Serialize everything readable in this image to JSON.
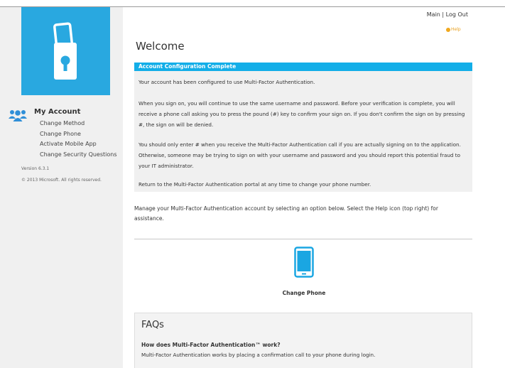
{
  "top_nav": {
    "main_label": "Main",
    "separator": " | ",
    "logout_label": "Log Out"
  },
  "help": {
    "label": "Help"
  },
  "sidebar": {
    "logo_icon": "phone-lock-icon",
    "account_icon": "users-icon",
    "account_title": "My Account",
    "links": [
      "Change Method",
      "Change Phone",
      "Activate Mobile App",
      "Change Security Questions"
    ],
    "version": "Version 6.3.1",
    "copyright": "© 2013 Microsoft. All rights reserved."
  },
  "page": {
    "title": "Welcome",
    "alert": {
      "header": "Account Configuration Complete",
      "paragraphs": [
        "Your account has been configured to use Multi-Factor Authentication.",
        "When you sign on, you will continue to use the same username and password. Before your verification is complete, you will receive a phone call asking you to press the pound (#) key to confirm your sign on. If you don't confirm the sign on by pressing #, the sign on will be denied.",
        "You should only enter # when you receive the Multi-Factor Authentication call if you are actually signing on to the application. Otherwise, someone may be trying to sign on with your username and password and you should report this potential fraud to your IT administrator.",
        "Return to the Multi-Factor Authentication portal at any time to change your phone number."
      ]
    },
    "manage_text": "Manage your Multi-Factor Authentication account by selecting an option below. Select the Help icon (top right) for assistance.",
    "options": [
      {
        "label": "Change Phone",
        "icon": "mobile-phone-icon"
      }
    ],
    "faq": {
      "title": "FAQs",
      "question": "How does Multi-Factor Authentication™ work?",
      "answer": "Multi-Factor Authentication works by placing a confirmation call to your phone during login."
    }
  },
  "colors": {
    "brand_blue": "#29a8e0",
    "header_blue": "#13aee8",
    "help_orange": "#f0a81e"
  }
}
